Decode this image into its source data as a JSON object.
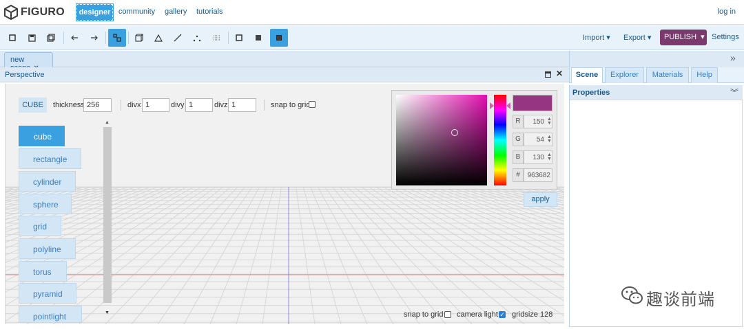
{
  "app": {
    "name": "FIGURO"
  },
  "nav": {
    "links": [
      "designer",
      "community",
      "gallery",
      "tutorials"
    ],
    "active": "designer",
    "login": "log in"
  },
  "toolbar": {
    "left_icons": [
      "new-icon",
      "save-icon",
      "save-as-icon",
      "undo-icon",
      "redo-icon",
      "select-icon",
      "cube-outline-icon",
      "triangle-icon",
      "line-icon",
      "points-icon",
      "pattern-icon",
      "wire-square-icon",
      "solid-square-icon",
      "textured-square-icon"
    ],
    "import": "Import",
    "export": "Export",
    "publish": "PUBLISH",
    "settings": "Settings"
  },
  "tabs": {
    "scene_tab": "new scene",
    "close": "✕"
  },
  "panel": {
    "title": "Perspective"
  },
  "params": {
    "shape": "CUBE",
    "thickness_label": "thickness",
    "thickness": "256",
    "divx_label": "divx",
    "divx": "1",
    "divy_label": "divy",
    "divy": "1",
    "divz_label": "divz",
    "divz": "1",
    "snap_label": "snap to grid"
  },
  "shapes": [
    "cube",
    "rectangle",
    "cylinder",
    "sphere",
    "grid",
    "polyline",
    "torus",
    "pyramid",
    "pointlight"
  ],
  "selected_shape": "cube",
  "color_picker": {
    "r_label": "R",
    "r": "150",
    "g_label": "G",
    "g": "54",
    "b_label": "B",
    "b": "130",
    "hex_label": "#",
    "hex": "963682",
    "swatch_color": "#963682",
    "apply": "apply"
  },
  "viewport": {
    "snap_label": "snap to grid",
    "camera_light_label": "camera light",
    "camera_light": true,
    "gridsize_label": "gridsize 128"
  },
  "right_panel": {
    "tabs": [
      "Scene",
      "Explorer",
      "Materials",
      "Help"
    ],
    "active_tab": "Scene",
    "properties_title": "Properties"
  },
  "watermark": "趣谈前端",
  "colors": {
    "accent": "#3aa0e0",
    "publish": "#7b3a6d",
    "link": "#1a5a8a"
  }
}
